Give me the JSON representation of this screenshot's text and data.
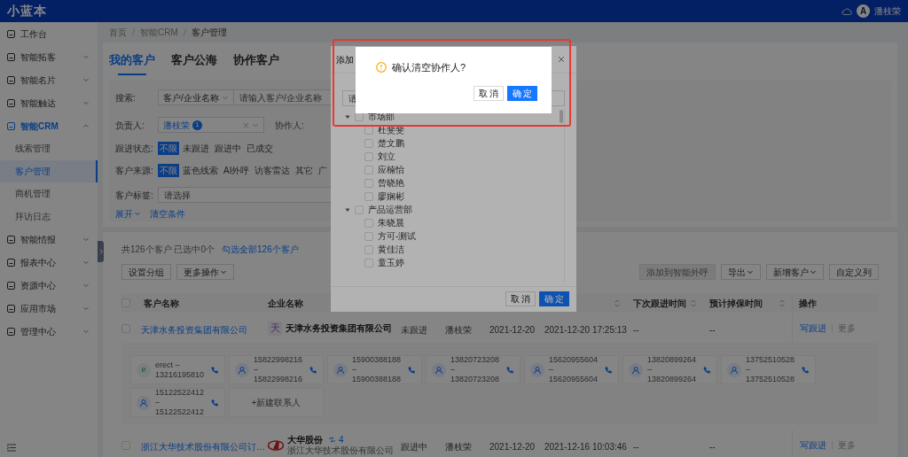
{
  "header": {
    "logo": "小蓝本",
    "user_avatar": "A",
    "user_name": "潘枝荣"
  },
  "sidebar": {
    "items": [
      {
        "kind": "link",
        "label": "工作台",
        "selected": false
      },
      {
        "kind": "group",
        "label": "智能拓客",
        "expanded": false,
        "selected": false
      },
      {
        "kind": "group",
        "label": "智能名片",
        "expanded": false,
        "selected": false
      },
      {
        "kind": "group",
        "label": "智能触达",
        "expanded": false,
        "selected": false
      },
      {
        "kind": "group",
        "label": "智能CRM",
        "expanded": true,
        "selected": true,
        "children": [
          {
            "label": "线索管理",
            "selected": false
          },
          {
            "label": "客户管理",
            "selected": true
          },
          {
            "label": "商机管理",
            "selected": false
          },
          {
            "label": "拜访日志",
            "selected": false
          }
        ]
      },
      {
        "kind": "group",
        "label": "智能情报",
        "expanded": false,
        "selected": false
      },
      {
        "kind": "group",
        "label": "报表中心",
        "expanded": false,
        "selected": false
      },
      {
        "kind": "group",
        "label": "资源中心",
        "expanded": false,
        "selected": false
      },
      {
        "kind": "group",
        "label": "应用市场",
        "expanded": false,
        "selected": false
      },
      {
        "kind": "group",
        "label": "管理中心",
        "expanded": false,
        "selected": false
      }
    ]
  },
  "breadcrumb": [
    "首页",
    "智能CRM",
    "客户管理"
  ],
  "tabs": [
    {
      "label": "我的客户",
      "selected": true
    },
    {
      "label": "客户公海",
      "selected": false
    },
    {
      "label": "协作客户",
      "selected": false
    }
  ],
  "filters": {
    "search": {
      "label": "搜索:",
      "select": "客户/企业名称",
      "placeholder": "请输入客户/企业名称"
    },
    "owner": {
      "label": "负责人:",
      "tag": "潘枝荣",
      "count": "1"
    },
    "collaborator_label": "协作人:",
    "follow_status": {
      "label": "跟进状态:",
      "options": [
        {
          "label": "不限",
          "selected": true
        },
        {
          "label": "未跟进",
          "selected": false
        },
        {
          "label": "跟进中",
          "selected": false
        },
        {
          "label": "已成交",
          "selected": false
        }
      ]
    },
    "source": {
      "label": "客户来源:",
      "options": [
        {
          "label": "不限",
          "selected": true
        },
        {
          "label": "蓝色线索",
          "selected": false
        },
        {
          "label": "AI外呼",
          "selected": false
        },
        {
          "label": "访客雷达",
          "selected": false
        },
        {
          "label": "其它",
          "selected": false
        },
        {
          "label": "广",
          "selected": false
        }
      ]
    },
    "tags": {
      "label": "客户标签:",
      "placeholder": "请选择"
    },
    "links": [
      {
        "label": "展开",
        "caret": true
      },
      {
        "label": "清空条件",
        "caret": false
      }
    ]
  },
  "summary": {
    "text": "共126个客户 已选中0个",
    "link": "勾选全部126个客户"
  },
  "toolbar_left": [
    {
      "label": "设置分组",
      "caret": false,
      "disabled": false
    },
    {
      "label": "更多操作",
      "caret": true,
      "disabled": false
    }
  ],
  "toolbar_right": [
    {
      "label": "添加到智能外呼",
      "caret": false,
      "disabled": true
    },
    {
      "label": "导出",
      "caret": true,
      "disabled": false
    },
    {
      "label": "新增客户",
      "caret": true,
      "disabled": false
    },
    {
      "label": "自定义列",
      "caret": false,
      "disabled": false
    }
  ],
  "table": {
    "all_selected": false,
    "columns": [
      {
        "label": "客户名称",
        "sortable": false
      },
      {
        "label": "企业名称"
      },
      {
        "sortable": true
      },
      {
        "label": "下次跟进时间",
        "sortable": true
      },
      {
        "label": "预计掉保时间",
        "sortable": true
      },
      {
        "label": "操作",
        "sortable": false
      }
    ],
    "rows": [
      {
        "selected": false,
        "customer": "天津水务投资集团有限公司",
        "company": {
          "kind": "letter",
          "logo": "天",
          "name": "天津水务投资集团有限公司"
        },
        "status": "未跟进",
        "owner": "潘枝荣",
        "created": "2021-12-20",
        "last_follow": "2021-12-20 17:25:13",
        "next_follow": "--",
        "expire": "--",
        "actions": [
          "写跟进",
          "更多"
        ],
        "contacts": [
          {
            "kind": "letter",
            "initial": "e",
            "label": "erect – 13216195810"
          },
          {
            "kind": "person",
            "label": "15822998216 – 15822998216"
          },
          {
            "kind": "person",
            "label": "15900388188 – 15900388188"
          },
          {
            "kind": "person",
            "label": "13820723208 – 13820723208"
          },
          {
            "kind": "person",
            "label": "15620955604 – 15620955604"
          },
          {
            "kind": "person",
            "label": "13820899264 – 13820899264"
          },
          {
            "kind": "person",
            "label": "13752510528 – 13752510528"
          },
          {
            "kind": "person",
            "label": "15122522412 – 15122522412"
          }
        ],
        "new_contact": "+新建联系人"
      },
      {
        "selected": false,
        "customer": "浙江大华技术股份有限公司订…",
        "company": {
          "kind": "image",
          "name": "大华股份",
          "linked": "4",
          "full_name": "浙江大华技术股份有限公司"
        },
        "status": "跟进中",
        "owner": "潘枝荣",
        "created": "2021-12-20",
        "last_follow": "2021-12-16 10:03:46",
        "next_follow": "--",
        "expire": "--",
        "actions": [
          "写跟进",
          "更多"
        ]
      }
    ]
  },
  "add_dialog": {
    "title": "添加",
    "search_placeholder": "请",
    "groups": [
      {
        "label": "市场部",
        "expanded": true,
        "checked": false,
        "children": [
          {
            "label": "杜斐斐",
            "checked": false
          },
          {
            "label": "楚文鹏",
            "checked": false
          },
          {
            "label": "刘立",
            "checked": false
          },
          {
            "label": "应楠怡",
            "checked": false
          },
          {
            "label": "曾晓艳",
            "checked": false
          },
          {
            "label": "廖娴彬",
            "checked": false
          }
        ]
      },
      {
        "label": "产品运营部",
        "expanded": true,
        "checked": false,
        "children": [
          {
            "label": "朱晓晨",
            "checked": false
          },
          {
            "label": "方可-测试",
            "checked": false
          },
          {
            "label": "黄佳洁",
            "checked": false
          },
          {
            "label": "童玉婷",
            "checked": false
          }
        ]
      }
    ],
    "buttons": [
      {
        "label": "取 消",
        "kind": "default"
      },
      {
        "label": "确 定",
        "kind": "primary"
      }
    ]
  },
  "confirm": {
    "message": "确认清空协作人?",
    "buttons": [
      {
        "label": "取 消",
        "kind": "default"
      },
      {
        "label": "确 定",
        "kind": "primary"
      }
    ]
  }
}
